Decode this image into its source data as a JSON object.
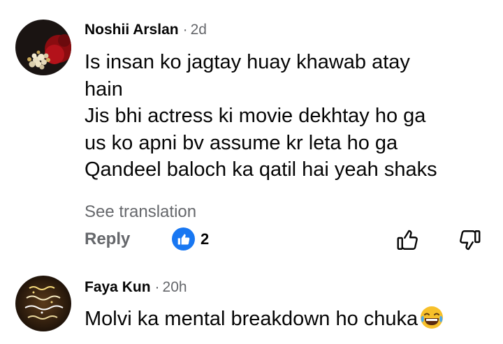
{
  "comments": [
    {
      "author": "Noshii Arslan",
      "separator": "·",
      "time": "2d",
      "lines": [
        "Is insan ko jagtay huay khawab atay",
        "hain",
        "Jis bhi actress ki movie dekhtay ho ga",
        "us ko apni bv assume kr leta ho ga",
        "Qandeel baloch ka qatil hai yeah shaks"
      ],
      "see_translation": "See translation",
      "reply": "Reply",
      "reaction_count": "2",
      "reaction_type": "like-icon"
    },
    {
      "author": "Faya Kun",
      "separator": "·",
      "time": "20h",
      "text": "Molvi ka mental breakdown ho chuka",
      "emoji": "face-with-tears-of-joy"
    }
  ],
  "icons": {
    "like_action": "thumbs-up-outline-icon",
    "dislike_action": "thumbs-down-outline-icon"
  },
  "colors": {
    "like_blue": "#1877f2",
    "secondary_text": "#65676b",
    "primary_text": "#050505"
  }
}
